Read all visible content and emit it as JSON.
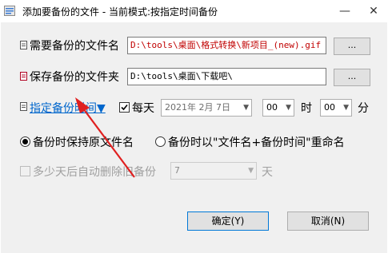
{
  "window": {
    "title": "添加要备份的文件 - 当前模式:按指定时间备份",
    "minimize_glyph": "—",
    "close_glyph": "✕"
  },
  "source_file": {
    "label": "需要备份的文件名",
    "value": "D:\\tools\\桌面\\格式转换\\新项目_(new).gif",
    "browse_label": "..."
  },
  "dest_folder": {
    "label": "保存备份的文件夹",
    "value": "D:\\tools\\桌面\\下载吧\\",
    "browse_label": "..."
  },
  "schedule": {
    "link_label": "指定备份时间▼",
    "daily_label": "每天",
    "daily_checked": true,
    "date_value": "2021年 2月 7日",
    "hour_value": "00",
    "hour_unit": "时",
    "minute_value": "00",
    "minute_unit": "分"
  },
  "naming": {
    "keep_original_label": "备份时保持原文件名",
    "rename_label": "备份时以\"文件名+备份时间\"重命名",
    "selected": "keep_original"
  },
  "auto_delete": {
    "label": "多少天后自动删除旧备份",
    "days_value": "7",
    "days_unit": "天",
    "enabled": false
  },
  "footer": {
    "ok_label": "确定(Y)",
    "cancel_label": "取消(N)"
  },
  "colors": {
    "accent_blue": "#0066cc",
    "error_red": "#c00000",
    "window_bg": "#f0f0f0"
  }
}
